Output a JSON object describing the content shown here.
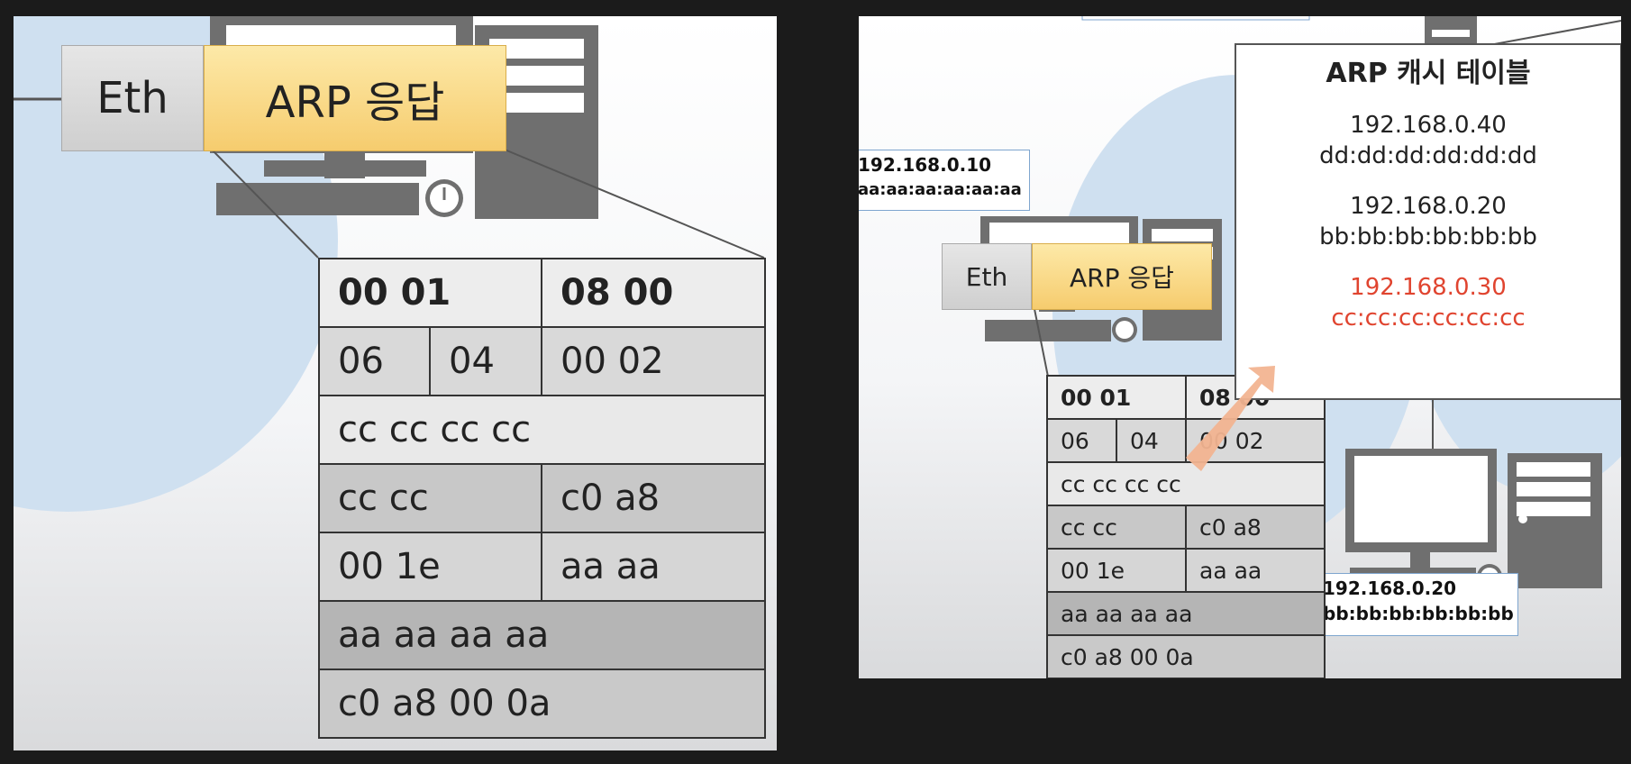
{
  "colors": {
    "background": "#1b1b1b",
    "eth_fill": "#d8d8d8",
    "arp_fill": "#f9d98a",
    "highlight_entry": "#e0442f",
    "network_circle": "#cfe0f0",
    "arrow": "#f2b491"
  },
  "left": {
    "eth_label": "Eth",
    "arp_label": "ARP 응답",
    "packet": {
      "row1": [
        "00  01",
        "08  00"
      ],
      "row2": [
        "06",
        "04",
        "00  02"
      ],
      "row3": [
        "cc  cc  cc  cc"
      ],
      "row4": [
        "cc  cc",
        "c0  a8"
      ],
      "row5": [
        "00  1e",
        "aa  aa"
      ],
      "row6": [
        "aa  aa  aa  aa"
      ],
      "row7": [
        "c0  a8  00  0a"
      ]
    }
  },
  "right": {
    "eth_label": "Eth",
    "arp_label": "ARP 응답",
    "host_a": {
      "ip": "192.168.0.10",
      "mac": "aa:aa:aa:aa:aa:aa"
    },
    "host_b": {
      "ip": "192.168.0.20",
      "mac": "bb:bb:bb:bb:bb:bb"
    },
    "cache_table": {
      "title": "ARP 캐시 테이블",
      "entries": [
        {
          "ip": "192.168.0.40",
          "mac": "dd:dd:dd:dd:dd:dd"
        },
        {
          "ip": "192.168.0.20",
          "mac": "bb:bb:bb:bb:bb:bb"
        },
        {
          "ip": "192.168.0.30",
          "mac": "cc:cc:cc:cc:cc:cc"
        }
      ]
    },
    "packet": {
      "row1": [
        "00  01",
        "08  00"
      ],
      "row2": [
        "06",
        "04",
        "00  02"
      ],
      "row3": [
        "cc  cc  cc  cc"
      ],
      "row4": [
        "cc  cc",
        "c0  a8"
      ],
      "row5": [
        "00  1e",
        "aa  aa"
      ],
      "row6": [
        "aa  aa  aa  aa"
      ],
      "row7": [
        "c0  a8  00  0a"
      ]
    }
  }
}
